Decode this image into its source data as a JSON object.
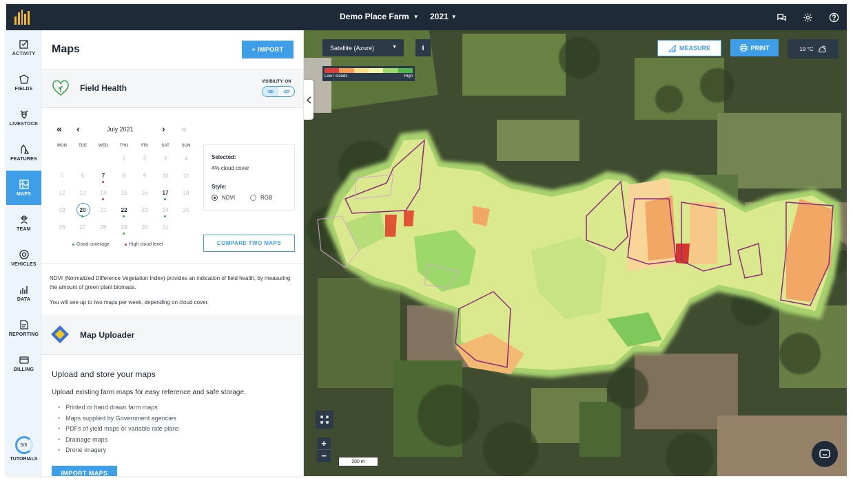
{
  "header": {
    "farm_name": "Demo Place Farm",
    "year": "2021"
  },
  "nav": {
    "items": [
      {
        "label": "ACTIVITY",
        "icon": "activity-icon"
      },
      {
        "label": "FIELDS",
        "icon": "fields-icon"
      },
      {
        "label": "LIVESTOCK",
        "icon": "livestock-icon"
      },
      {
        "label": "FEATURES",
        "icon": "features-icon"
      },
      {
        "label": "MAPS",
        "icon": "maps-icon"
      },
      {
        "label": "TEAM",
        "icon": "team-icon"
      },
      {
        "label": "VEHICLES",
        "icon": "vehicles-icon"
      },
      {
        "label": "DATA",
        "icon": "data-icon"
      },
      {
        "label": "REPORTING",
        "icon": "reporting-icon"
      },
      {
        "label": "BILLING",
        "icon": "billing-icon"
      }
    ],
    "tutorials_progress": "5/6",
    "tutorials_label": "TUTORIALS"
  },
  "panel": {
    "title": "Maps",
    "import_button": "+ IMPORT",
    "field_health": {
      "title": "Field Health",
      "visibility_label": "VISIBILITY: ON"
    },
    "calendar": {
      "month": "July 2021",
      "weekdays": [
        "MON",
        "TUE",
        "WED",
        "THU",
        "FRI",
        "SAT",
        "SUN"
      ],
      "days": [
        "1",
        "2",
        "3",
        "4",
        "5",
        "6",
        "7",
        "8",
        "9",
        "10",
        "11",
        "12",
        "13",
        "14",
        "15",
        "16",
        "17",
        "18",
        "19",
        "20",
        "21",
        "22",
        "23",
        "24",
        "25",
        "26",
        "27",
        "28",
        "29",
        "30",
        "31"
      ],
      "legend_good": "Good coverage",
      "legend_cloud": "High cloud level"
    },
    "selected": {
      "title": "Selected:",
      "cloud": "4% cloud cover",
      "style_label": "Style:",
      "ndvi": "NDVI",
      "rgb": "RGB"
    },
    "compare_button": "COMPARE TWO MAPS",
    "ndvi_text": "NDVI (Normalized Difference Vegetation Index) provides an indication of field health, by measuring the amount of green plant biomass.",
    "frequency_text": "You will see up to two maps per week, depending on cloud cover.",
    "map_uploader": {
      "title": "Map Uploader",
      "heading": "Upload and store your maps",
      "description": "Upload existing farm maps for easy reference and safe storage.",
      "bullets": [
        "Printed or hand drawn farm maps",
        "Maps supplied by Government agencies",
        "PDFs of yield maps or variable rate plans",
        "Drainage maps",
        "Drone imagery"
      ],
      "button": "IMPORT MAPS"
    }
  },
  "map": {
    "layer": "Satellite (Azure)",
    "scale_low": "Low / clouds",
    "scale_high": "High",
    "measure_button": "MEASURE",
    "print_button": "PRINT",
    "temperature": "19 °C",
    "scale_distance": "200 m",
    "colors": {
      "ndvi_scale": [
        "#d9403a",
        "#f59a55",
        "#fbe08a",
        "#f3f6a8",
        "#9fd86a",
        "#52b64a"
      ]
    }
  }
}
